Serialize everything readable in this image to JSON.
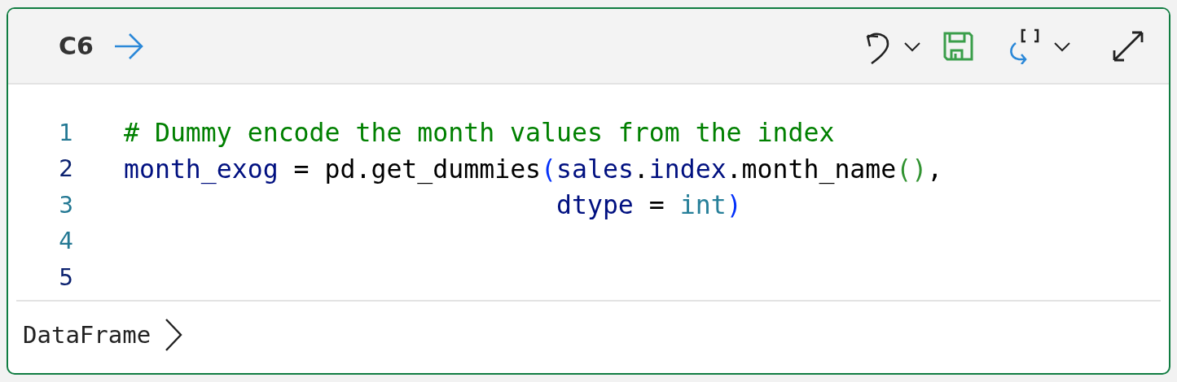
{
  "cell": {
    "label": "C6",
    "code_lines": [
      {
        "number": "1",
        "color": "#237893",
        "tokens": [
          {
            "kind": "comment",
            "text": "# Dummy encode the month values from the index"
          }
        ]
      },
      {
        "number": "2",
        "color": "#0b216f",
        "tokens": [
          {
            "kind": "name",
            "text": "month_exog"
          },
          {
            "kind": "plain",
            "text": " = pd.get_dummies"
          },
          {
            "kind": "paren",
            "text": "("
          },
          {
            "kind": "name",
            "text": "sales"
          },
          {
            "kind": "plain",
            "text": "."
          },
          {
            "kind": "name",
            "text": "index"
          },
          {
            "kind": "plain",
            "text": ".month_name"
          },
          {
            "kind": "paren2",
            "text": "()"
          },
          {
            "kind": "plain",
            "text": ","
          }
        ]
      },
      {
        "number": "3",
        "color": "#237893",
        "kind": "continuation",
        "tokens": [
          {
            "kind": "name",
            "text": "dtype"
          },
          {
            "kind": "plain",
            "text": " = "
          },
          {
            "kind": "builtin",
            "text": "int"
          },
          {
            "kind": "paren",
            "text": ")"
          }
        ]
      },
      {
        "number": "4",
        "color": "#237893"
      },
      {
        "number": "5",
        "color": "#0b216f"
      }
    ],
    "output_type": "DataFrame"
  }
}
